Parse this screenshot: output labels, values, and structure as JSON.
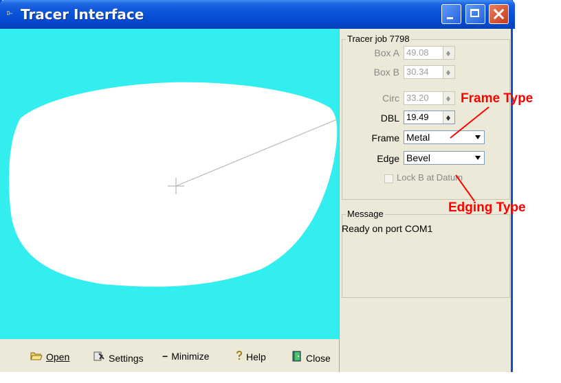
{
  "window": {
    "title": "Tracer Interface",
    "icon_text": "D~"
  },
  "tracer": {
    "group_title": "Tracer job 7798",
    "fields": [
      {
        "label": "Box A",
        "value": "49.08",
        "enabled": false
      },
      {
        "label": "Box B",
        "value": "30.34",
        "enabled": false
      },
      {
        "label": "Circ",
        "value": "33.20",
        "enabled": false
      },
      {
        "label": "DBL",
        "value": "19.49",
        "enabled": true
      }
    ],
    "frame": {
      "label": "Frame",
      "value": "Metal"
    },
    "edge": {
      "label": "Edge",
      "value": "Bevel"
    },
    "lock_label": "Lock B at Datum"
  },
  "message": {
    "group_title": "Message",
    "text": "Ready on port COM1"
  },
  "toolbar": {
    "open": "Open",
    "settings": "Settings",
    "minimize": "Minimize",
    "help": "Help",
    "close": "Close"
  },
  "annotations": {
    "frame_type": "Frame Type",
    "edging_type": "Edging Type"
  },
  "colors": {
    "canvas": "#33eeee",
    "lens": "#ffffff",
    "annotation": "#ff0000",
    "titlebar": "#0a53d8"
  }
}
